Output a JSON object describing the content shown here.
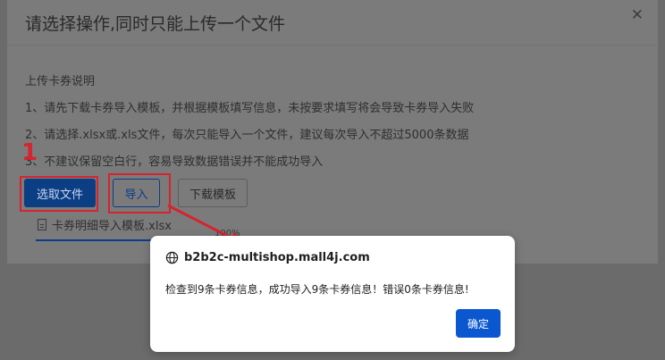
{
  "dialog": {
    "title": "请选择操作,同时只能上传一个文件",
    "close_icon": "close-icon",
    "instructions_title": "上传卡券说明",
    "instructions": [
      "1、请先下载卡券导入模板，并根据模板填写信息，未按要求填写将会导致卡券导入失败",
      "2、请选择.xlsx或.xls文件，每次只能导入一个文件，建议每次导入不超过5000条数据",
      "3、不建议保留空白行，容易导致数据错误并不能成功导入"
    ],
    "buttons": {
      "select_file": "选取文件",
      "import": "导入",
      "download_template": "下载模板"
    },
    "file": {
      "name": "卡券明细导入模板.xlsx",
      "icon": "document-icon",
      "progress_label": "100%"
    }
  },
  "annotation": {
    "step_number": "1",
    "highlight_color": "#d6242f"
  },
  "alert": {
    "origin": "b2b2c-multishop.mall4j.com",
    "origin_icon": "globe-icon",
    "message": "检查到9条卡券信息，成功导入9条卡券信息！错误0条卡券信息!",
    "ok_label": "确定",
    "accent_color": "#0b57d0"
  }
}
